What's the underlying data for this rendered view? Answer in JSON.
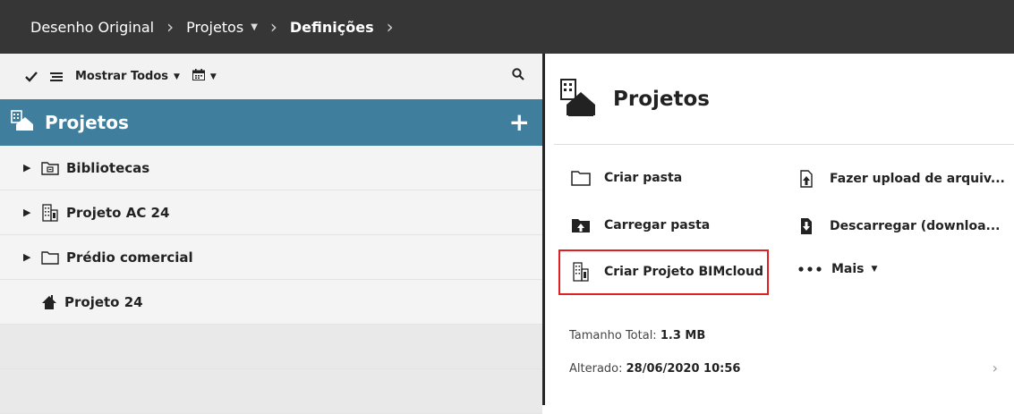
{
  "breadcrumb": {
    "items": [
      {
        "label": "Desenho Original"
      },
      {
        "label": "Projetos"
      },
      {
        "label": "Definições"
      }
    ]
  },
  "toolbar": {
    "filter_label": "Mostrar Todos"
  },
  "tree_header": {
    "title": "Projetos"
  },
  "tree": {
    "items": [
      {
        "label": "Bibliotecas"
      },
      {
        "label": "Projeto AC 24"
      },
      {
        "label": "Prédio comercial"
      },
      {
        "label": "Projeto 24"
      }
    ]
  },
  "details": {
    "title": "Projetos",
    "actions": {
      "create_folder": "Criar pasta",
      "upload_files": "Fazer upload de arquiv...",
      "upload_folder": "Carregar pasta",
      "download": "Descarregar (downloa...",
      "create_project": "Criar Projeto BIMcloud",
      "more": "Mais"
    },
    "size_label": "Tamanho Total:",
    "size_value": "1.3 MB",
    "modified_label": "Alterado:",
    "modified_value": "28/06/2020 10:56"
  },
  "colors": {
    "topbar": "#363636",
    "header_accent": "#3f7f9d",
    "highlight": "#e02020"
  }
}
